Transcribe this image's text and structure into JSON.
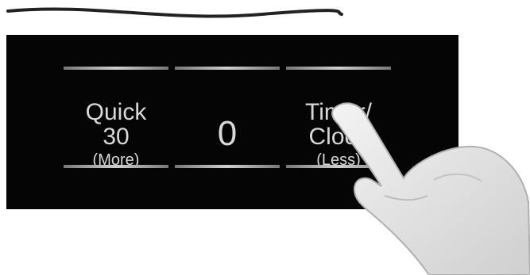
{
  "keys": [
    {
      "line1": "Quick",
      "line2": "30",
      "line3": "(More)"
    },
    {
      "display": "0"
    },
    {
      "line1": "Timer/",
      "line2": "Clock",
      "line3": "(Less)"
    }
  ],
  "colors": {
    "panel": "#050505",
    "text": "#d8d8d8",
    "rule": "#bdbdbd"
  }
}
